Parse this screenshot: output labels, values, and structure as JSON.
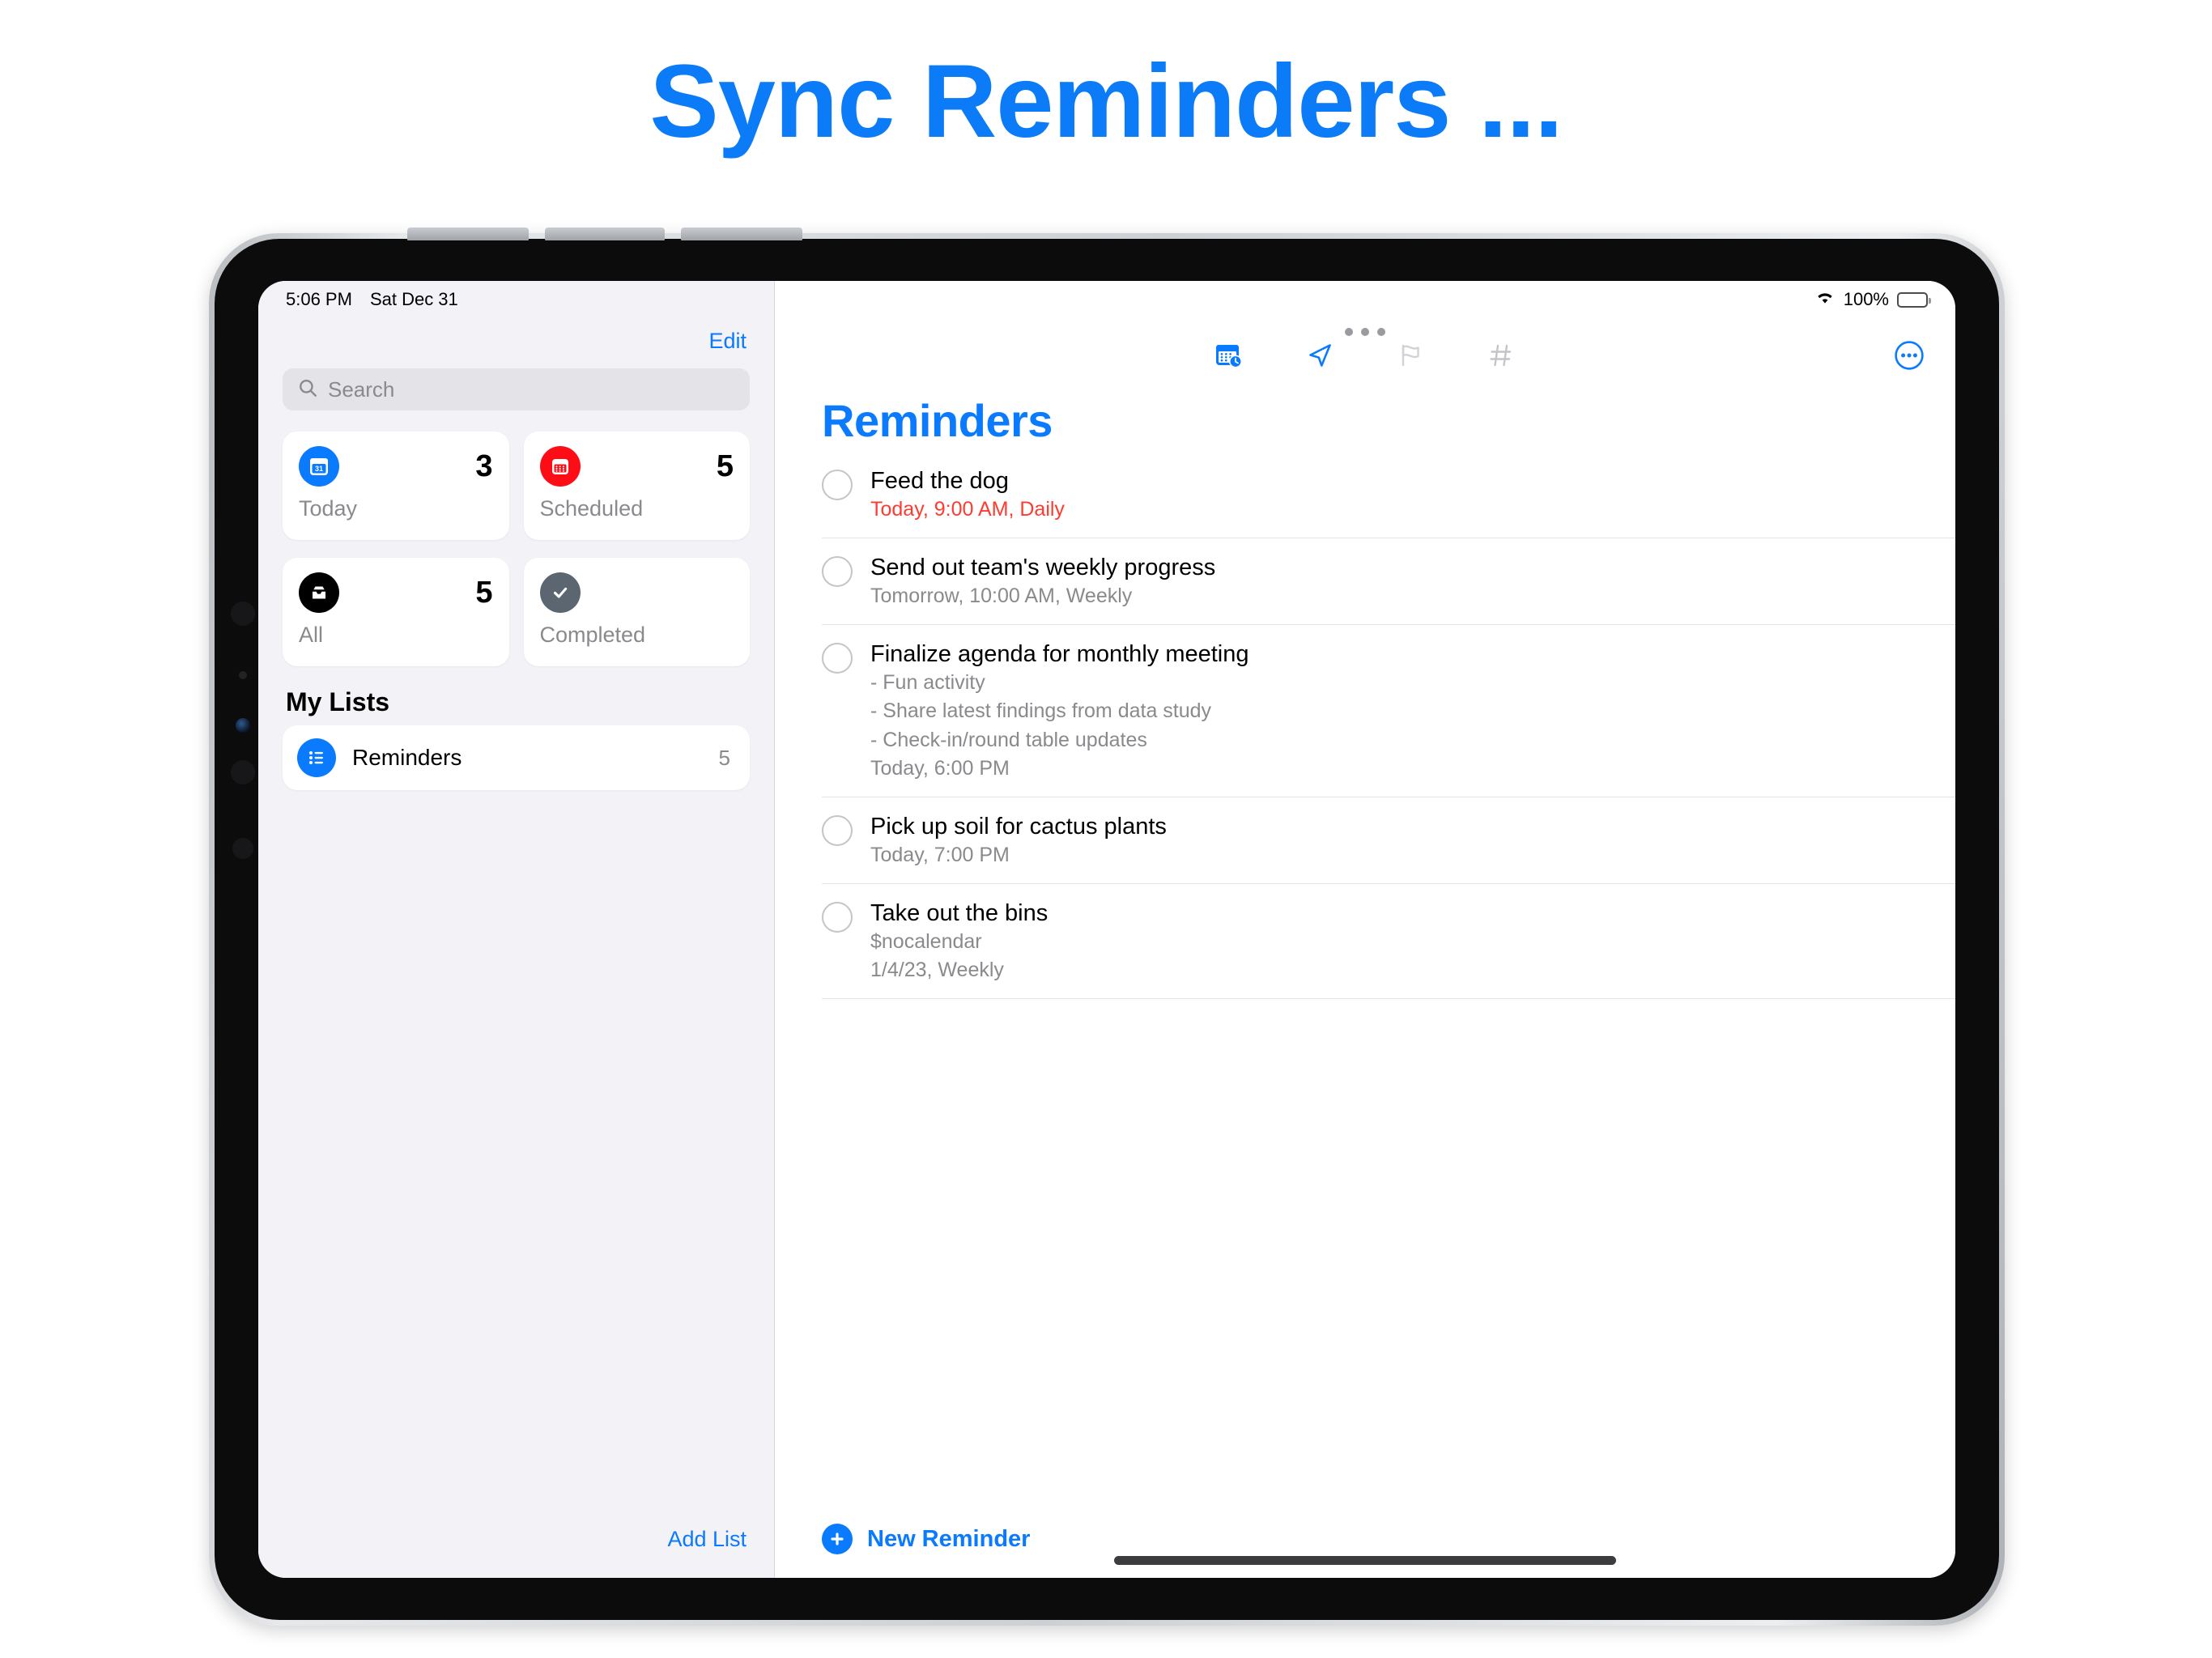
{
  "headline": "Sync Reminders ...",
  "colors": {
    "accent_blue": "#0a7aff",
    "headline_blue": "#0b7bf7",
    "overdue_red": "#ff3b30",
    "scheduled_red": "#ff0d17",
    "completed_gray": "#5c6670",
    "sidebar_bg": "#f2f2f7",
    "secondary_text": "#8a8a8e"
  },
  "statusbar": {
    "time": "5:06 PM",
    "date": "Sat Dec 31",
    "wifi_icon": "wifi-icon",
    "battery_percent": "100%",
    "battery_icon": "battery-full-icon"
  },
  "sidebar": {
    "edit_label": "Edit",
    "search": {
      "placeholder": "Search",
      "icon": "search-icon",
      "value": ""
    },
    "smart_lists": [
      {
        "key": "today",
        "label": "Today",
        "count": "3",
        "icon": "calendar-day-icon",
        "icon_color": "#0a7aff",
        "icon_glyph": "31"
      },
      {
        "key": "scheduled",
        "label": "Scheduled",
        "count": "5",
        "icon": "calendar-grid-icon",
        "icon_color": "#ff0d17"
      },
      {
        "key": "all",
        "label": "All",
        "count": "5",
        "icon": "inbox-tray-icon",
        "icon_color": "#000000"
      },
      {
        "key": "completed",
        "label": "Completed",
        "count": "",
        "icon": "checkmark-icon",
        "icon_color": "#5c6670"
      }
    ],
    "my_lists_header": "My Lists",
    "lists": [
      {
        "name": "Reminders",
        "count": "5",
        "icon": "bullet-list-icon",
        "icon_color": "#0a7aff"
      }
    ],
    "add_list_label": "Add List"
  },
  "detail": {
    "title": "Reminders",
    "multitask_icon": "multitask-dots-icon",
    "toolbar_icons": [
      {
        "name": "calendar-clock-icon",
        "active": true
      },
      {
        "name": "location-arrow-icon",
        "active": true
      },
      {
        "name": "flag-icon",
        "active": false
      },
      {
        "name": "hashtag-icon",
        "active": false
      }
    ],
    "more_icon": "more-circle-icon",
    "reminders": [
      {
        "title": "Feed the dog",
        "notes": [],
        "date": "Today, 9:00 AM, Daily",
        "overdue": true,
        "checkbox": "reminder-checkbox"
      },
      {
        "title": "Send out team's weekly progress",
        "notes": [],
        "date": "Tomorrow, 10:00 AM, Weekly",
        "overdue": false,
        "checkbox": "reminder-checkbox"
      },
      {
        "title": "Finalize agenda for monthly meeting",
        "notes": [
          "- Fun activity",
          "- Share latest findings from data study",
          "- Check-in/round table updates"
        ],
        "date": "Today, 6:00 PM",
        "overdue": false,
        "checkbox": "reminder-checkbox"
      },
      {
        "title": "Pick up soil for cactus plants",
        "notes": [],
        "date": "Today, 7:00 PM",
        "overdue": false,
        "checkbox": "reminder-checkbox"
      },
      {
        "title": "Take out the bins",
        "notes": [
          "$nocalendar"
        ],
        "date": "1/4/23, Weekly",
        "overdue": false,
        "checkbox": "reminder-checkbox"
      }
    ],
    "new_reminder_label": "New Reminder",
    "new_reminder_icon": "plus-circle-icon"
  }
}
